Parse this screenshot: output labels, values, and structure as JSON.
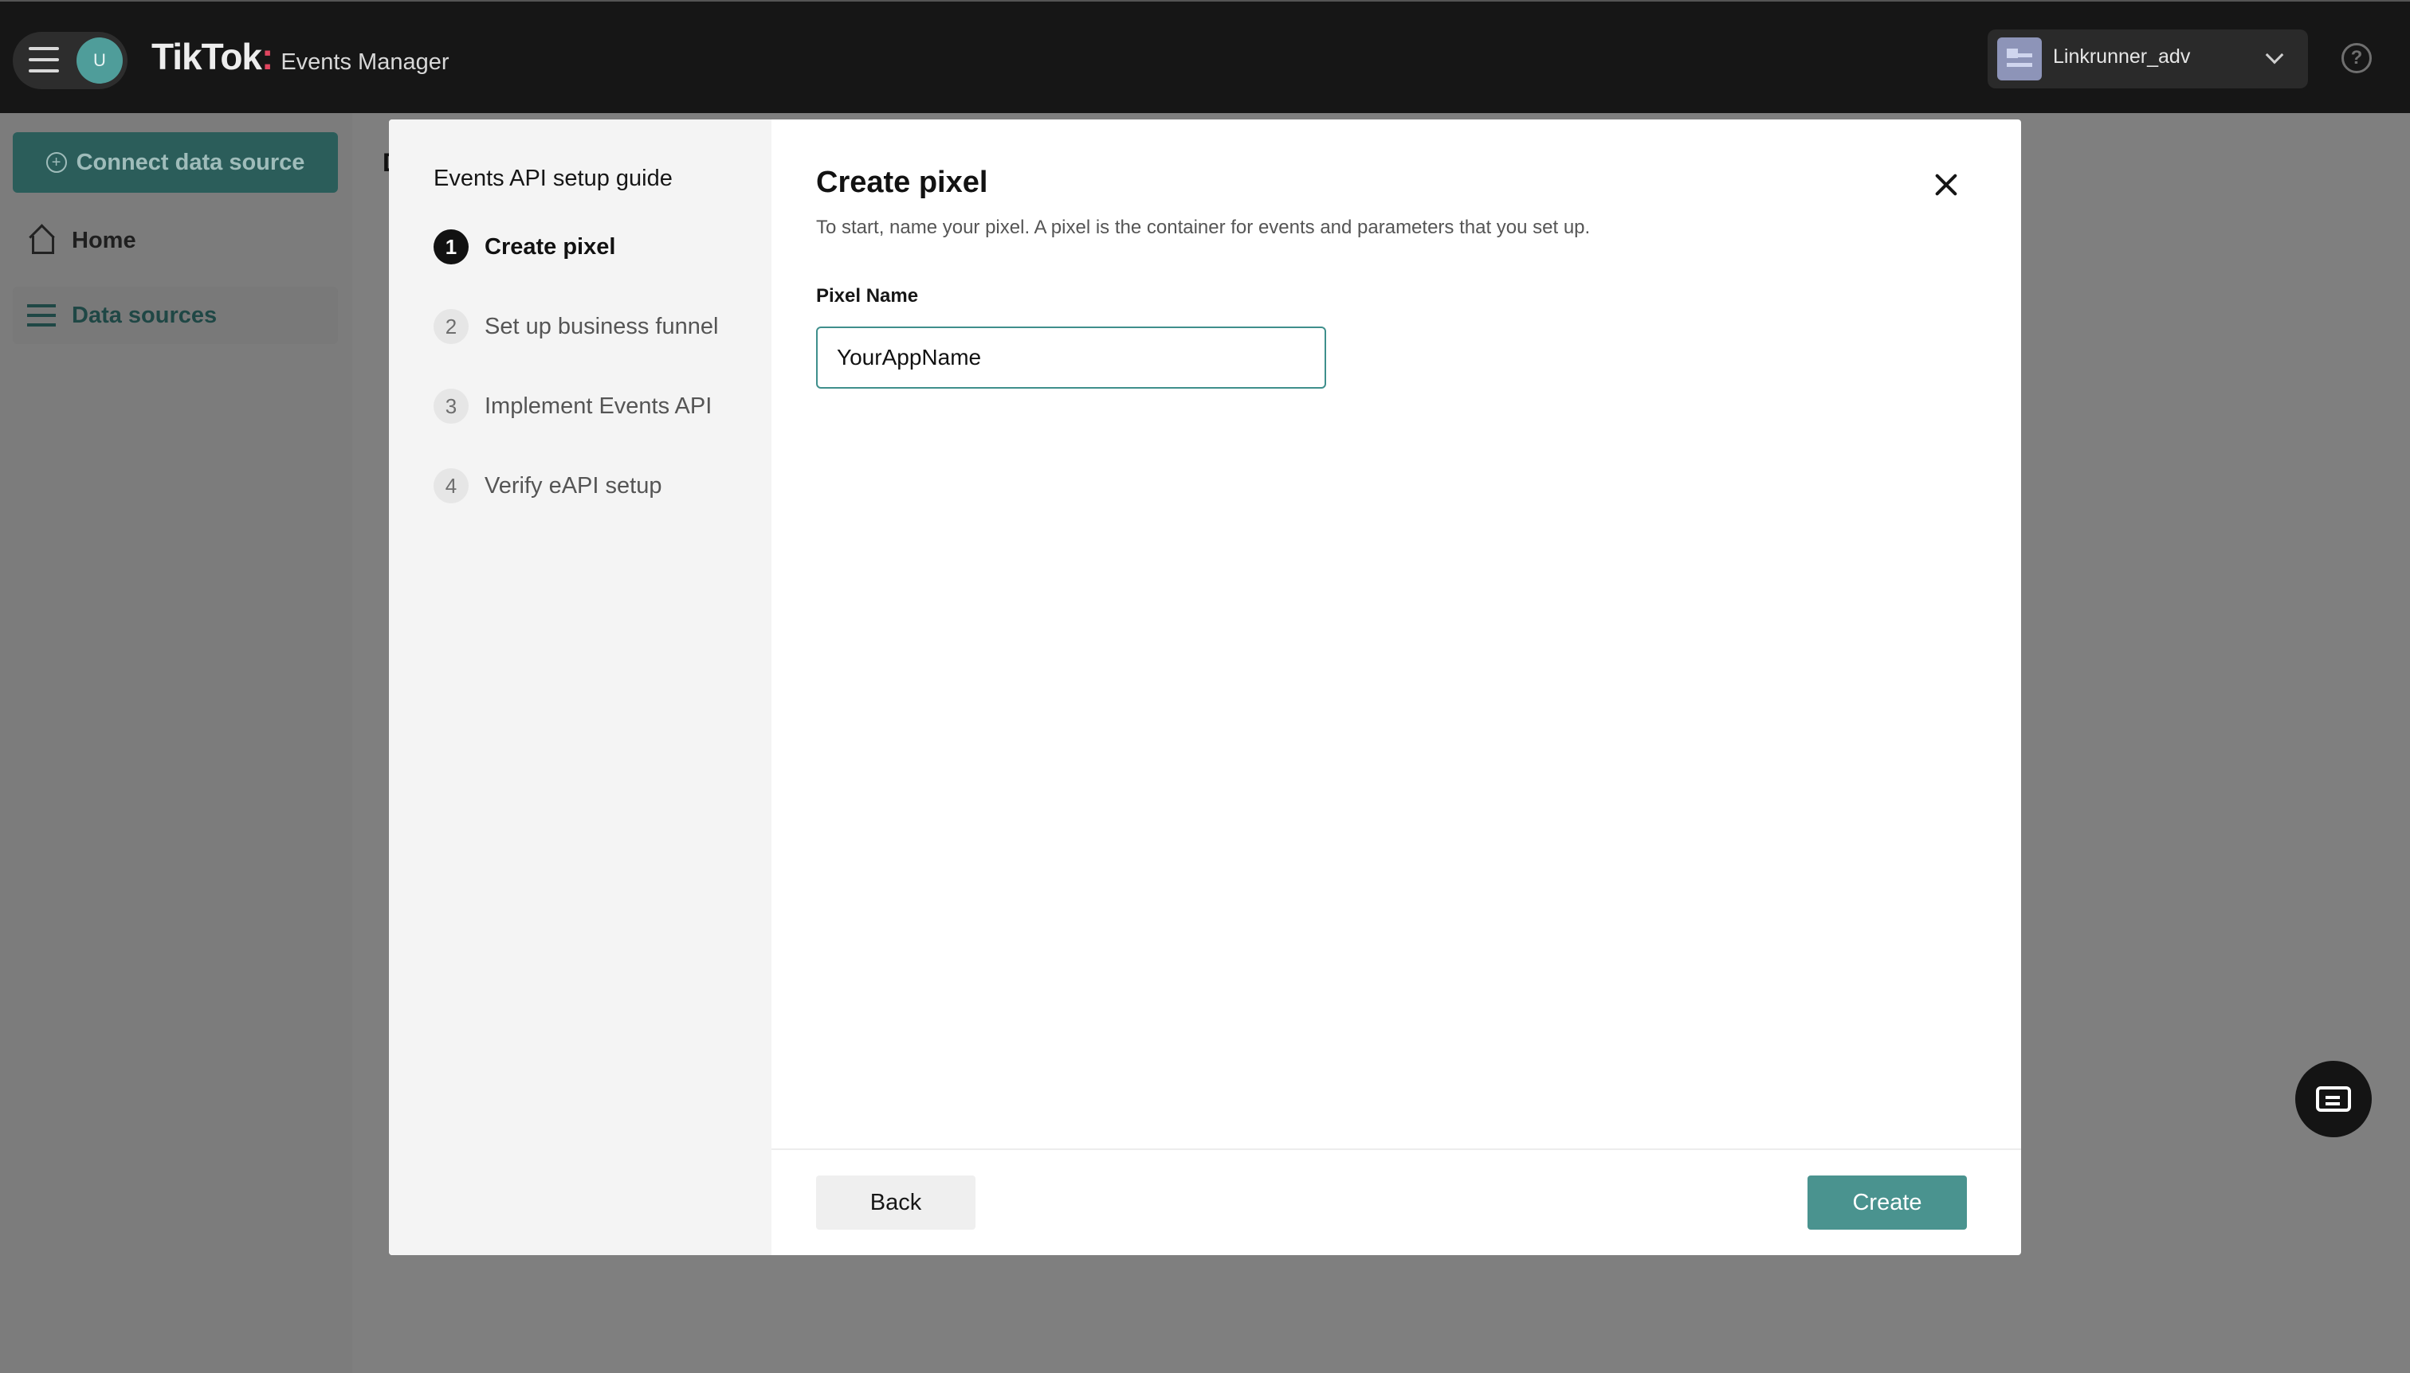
{
  "topbar": {
    "brand_logo": "TikTok",
    "brand_product": "Events Manager",
    "avatar_initial": "U",
    "account_name": "Linkrunner_adv",
    "help_glyph": "?"
  },
  "sidebar": {
    "connect_button": "Connect data source",
    "nav": [
      {
        "label": "Home",
        "icon": "home-icon"
      },
      {
        "label": "Data sources",
        "icon": "list-icon"
      }
    ]
  },
  "background": {
    "page_title_fragment": "D"
  },
  "modal": {
    "guide": {
      "title": "Events API setup guide",
      "steps": [
        {
          "num": "1",
          "label": "Create pixel",
          "active": true
        },
        {
          "num": "2",
          "label": "Set up business funnel",
          "active": false
        },
        {
          "num": "3",
          "label": "Implement Events API",
          "active": false
        },
        {
          "num": "4",
          "label": "Verify eAPI setup",
          "active": false
        }
      ]
    },
    "title": "Create pixel",
    "description": "To start, name your pixel. A pixel is the container for events and parameters that you set up.",
    "field_label": "Pixel Name",
    "field_value": "YourAppName",
    "back_label": "Back",
    "create_label": "Create"
  },
  "colors": {
    "accent": "#4a938f",
    "topbar": "#161616",
    "overlay": "#7f7f7f"
  }
}
